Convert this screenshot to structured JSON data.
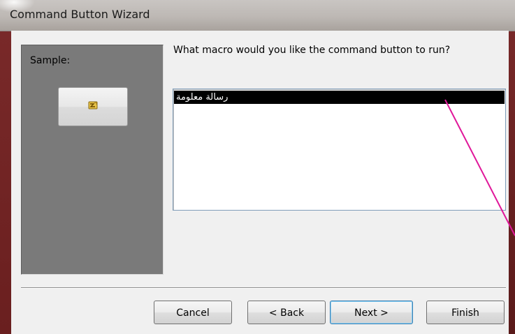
{
  "window": {
    "title": "Command Button Wizard"
  },
  "sample": {
    "label": "Sample:",
    "button_icon": "macro-icon"
  },
  "prompt": {
    "question": "What macro would you like the command button to run?"
  },
  "macro_list": {
    "items": [
      "رسالة معلومة"
    ],
    "selected_index": 0
  },
  "buttons": {
    "cancel": "Cancel",
    "back": "< Back",
    "next": "Next >",
    "finish": "Finish"
  },
  "colors": {
    "selection_bg": "#000000",
    "selection_text": "#ffffff",
    "annotation_line": "#e0189a",
    "sample_panel_bg": "#7a7a7a"
  }
}
